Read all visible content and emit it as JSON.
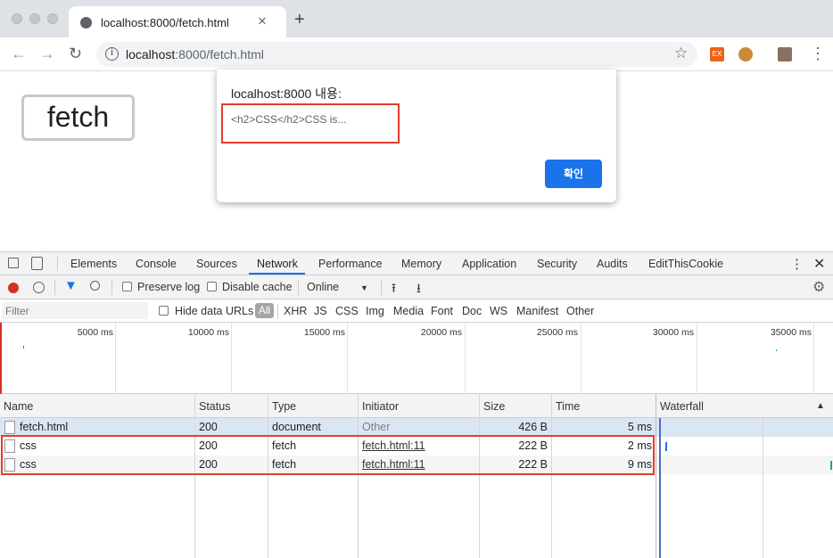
{
  "browser": {
    "tab_title": "localhost:8000/fetch.html",
    "new_tab_glyph": "+",
    "url_host": "localhost",
    "url_rest": ":8000/fetch.html",
    "back_glyph": "←",
    "forward_glyph": "→",
    "reload_glyph": "↻",
    "menu_glyph": "⋮",
    "ext_label": "EX"
  },
  "page": {
    "fetch_button_label": "fetch"
  },
  "dialog": {
    "heading": "localhost:8000 내용:",
    "message": "<h2>CSS</h2>CSS is...",
    "ok_label": "확인"
  },
  "devtools": {
    "tabs": [
      "Elements",
      "Console",
      "Sources",
      "Network",
      "Performance",
      "Memory",
      "Application",
      "Security",
      "Audits",
      "EditThisCookie"
    ],
    "active_tab": "Network",
    "preserve_log": "Preserve log",
    "disable_cache": "Disable cache",
    "throttle": "Online",
    "filter_placeholder": "Filter",
    "hide_data_urls": "Hide data URLs",
    "types": [
      "All",
      "XHR",
      "JS",
      "CSS",
      "Img",
      "Media",
      "Font",
      "Doc",
      "WS",
      "Manifest",
      "Other"
    ],
    "timeline_labels": [
      "5000 ms",
      "10000 ms",
      "15000 ms",
      "20000 ms",
      "25000 ms",
      "30000 ms",
      "35000 ms"
    ],
    "columns": [
      "Name",
      "Status",
      "Type",
      "Initiator",
      "Size",
      "Time",
      "Waterfall"
    ],
    "rows": [
      {
        "name": "fetch.html",
        "status": "200",
        "type": "document",
        "initiator": "Other",
        "size": "426 B",
        "time": "5 ms"
      },
      {
        "name": "css",
        "status": "200",
        "type": "fetch",
        "initiator": "fetch.html:11",
        "size": "222 B",
        "time": "2 ms"
      },
      {
        "name": "css",
        "status": "200",
        "type": "fetch",
        "initiator": "fetch.html:11",
        "size": "222 B",
        "time": "9 ms"
      }
    ]
  },
  "colors": {
    "accent_blue": "#1a73e8",
    "highlight_red": "#e53d2e",
    "record_red": "#d93025",
    "selected_row": "#dbe6f5"
  }
}
